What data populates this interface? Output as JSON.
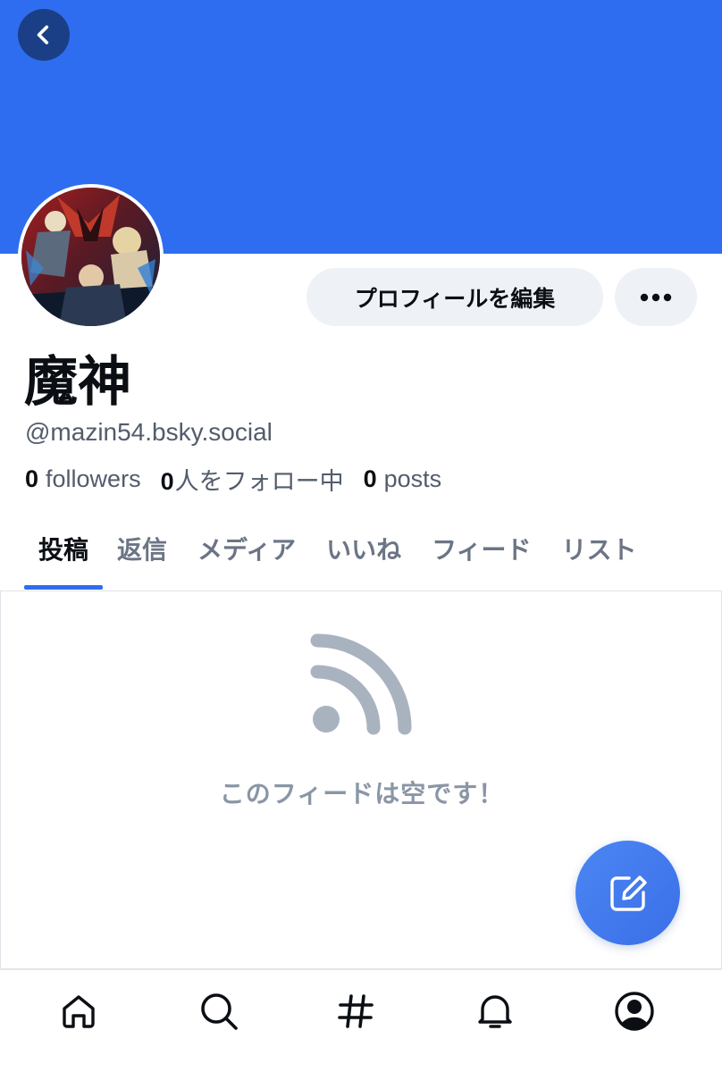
{
  "colors": {
    "banner": "#2f6df0",
    "accent": "#2f6df0",
    "button_bg": "#eef1f5",
    "muted_text": "#525c6b",
    "empty_icon": "#a9b3c0"
  },
  "header": {
    "back_icon": "chevron-left-icon"
  },
  "profile": {
    "display_name": "魔神",
    "handle": "@mazin54.bsky.social",
    "edit_button_label": "プロフィールを編集",
    "more_icon": "ellipsis-icon"
  },
  "stats": {
    "followers_count": "0",
    "followers_label": "followers",
    "following_count": "0",
    "following_label": "人をフォロー中",
    "posts_count": "0",
    "posts_label": "posts"
  },
  "tabs": [
    {
      "label": "投稿",
      "active": true
    },
    {
      "label": "返信",
      "active": false
    },
    {
      "label": "メディア",
      "active": false
    },
    {
      "label": "いいね",
      "active": false
    },
    {
      "label": "フィード",
      "active": false
    },
    {
      "label": "リスト",
      "active": false
    }
  ],
  "feed": {
    "empty_icon": "rss-icon",
    "empty_message": "このフィードは空です！"
  },
  "compose": {
    "icon": "compose-icon"
  },
  "bottom_nav": [
    {
      "icon": "home-icon"
    },
    {
      "icon": "search-icon"
    },
    {
      "icon": "hashtag-icon"
    },
    {
      "icon": "bell-icon"
    },
    {
      "icon": "profile-icon"
    }
  ]
}
